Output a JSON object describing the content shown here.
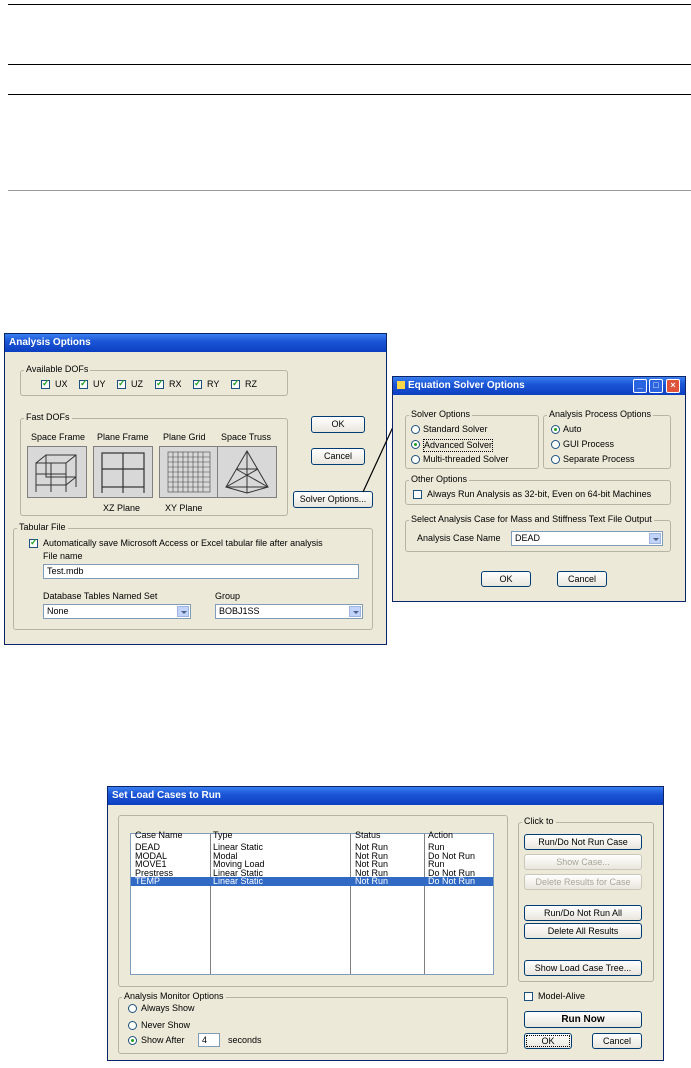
{
  "analysis_options": {
    "title": "Analysis Options",
    "available_dofs_label": "Available DOFs",
    "dofs": [
      {
        "label": "UX",
        "checked": true
      },
      {
        "label": "UY",
        "checked": true
      },
      {
        "label": "UZ",
        "checked": true
      },
      {
        "label": "RX",
        "checked": true
      },
      {
        "label": "RY",
        "checked": true
      },
      {
        "label": "RZ",
        "checked": true
      }
    ],
    "fast_dofs_label": "Fast DOFs",
    "fast_dofs": [
      {
        "label": "Space Frame",
        "sublabel": ""
      },
      {
        "label": "Plane Frame",
        "sublabel": "XZ Plane"
      },
      {
        "label": "Plane Grid",
        "sublabel": "XY Plane"
      },
      {
        "label": "Space Truss",
        "sublabel": ""
      }
    ],
    "ok_label": "OK",
    "cancel_label": "Cancel",
    "solver_options_label": "Solver Options...",
    "tabular_file_label": "Tabular File",
    "auto_save_label": "Automatically save Microsoft Access or Excel tabular file after analysis",
    "auto_save_checked": true,
    "file_name_label": "File name",
    "file_name_value": "Test.mdb",
    "db_tables_label": "Database Tables Named Set",
    "db_tables_value": "None",
    "group_label": "Group",
    "group_value": "BOBJ1SS"
  },
  "equation_solver": {
    "title": "Equation Solver Options",
    "solver_options_label": "Solver Options",
    "solvers": [
      {
        "label": "Standard Solver",
        "selected": false
      },
      {
        "label": "Advanced Solver",
        "selected": true
      },
      {
        "label": "Multi-threaded Solver",
        "selected": false
      }
    ],
    "process_options_label": "Analysis Process Options",
    "processes": [
      {
        "label": "Auto",
        "selected": true
      },
      {
        "label": "GUI Process",
        "selected": false
      },
      {
        "label": "Separate Process",
        "selected": false
      }
    ],
    "other_options_label": "Other Options",
    "always_32bit_label": "Always Run Analysis as 32-bit, Even on 64-bit Machines",
    "select_case_label": "Select Analysis Case for Mass and Stiffness Text File Output",
    "analysis_case_name_label": "Analysis Case Name",
    "analysis_case_value": "DEAD",
    "ok_label": "OK",
    "cancel_label": "Cancel"
  },
  "load_cases": {
    "title": "Set Load Cases to Run",
    "columns": [
      "Case Name",
      "Type",
      "Status",
      "Action"
    ],
    "rows": [
      {
        "name": "DEAD",
        "type": "Linear Static",
        "status": "Not Run",
        "action": "Run",
        "selected": false
      },
      {
        "name": "MODAL",
        "type": "Modal",
        "status": "Not Run",
        "action": "Do Not Run",
        "selected": false
      },
      {
        "name": "MOVE1",
        "type": "Moving Load",
        "status": "Not Run",
        "action": "Run",
        "selected": false
      },
      {
        "name": "Prestress",
        "type": "Linear Static",
        "status": "Not Run",
        "action": "Do Not Run",
        "selected": false
      },
      {
        "name": "TEMP",
        "type": "Linear Static",
        "status": "Not Run",
        "action": "Do Not Run",
        "selected": true
      }
    ],
    "click_to_label": "Click to",
    "buttons": {
      "run_do_not_run_case": "Run/Do Not Run Case",
      "show_case": "Show Case...",
      "delete_results_for_case": "Delete Results for Case",
      "run_do_not_run_all": "Run/Do Not Run All",
      "delete_all_results": "Delete All Results",
      "show_load_case_tree": "Show Load Case Tree..."
    },
    "monitor_label": "Analysis Monitor Options",
    "monitor_options": [
      {
        "label": "Always Show",
        "selected": false
      },
      {
        "label": "Never Show",
        "selected": false
      },
      {
        "label": "Show After",
        "selected": true
      }
    ],
    "show_after_value": "4",
    "seconds_label": "seconds",
    "model_alive_label": "Model-Alive",
    "run_now_label": "Run Now",
    "ok_label": "OK",
    "cancel_label": "Cancel"
  },
  "colors": {
    "selection": "#316ac5",
    "title_bar": "#1b56d6",
    "dialog_bg": "#ece9d8"
  }
}
